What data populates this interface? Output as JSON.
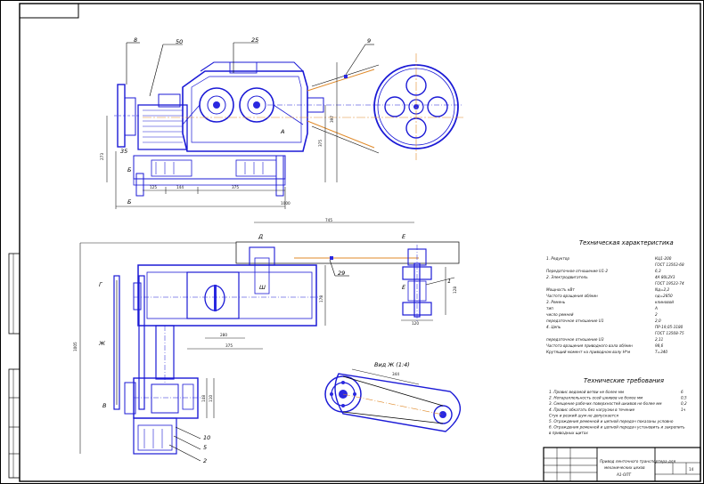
{
  "callouts": {
    "c8": "8",
    "c50": "50",
    "c25": "25",
    "c9": "9",
    "c29": "29",
    "c10": "10",
    "c5": "5",
    "c2": "2",
    "c1": "1",
    "cA": "А",
    "cB": "Б",
    "cB2": "Б",
    "cV": "В",
    "cG": "Г",
    "cZh": "Ж",
    "cD": "Д",
    "cE": "Е",
    "cE2": "Е",
    "cSh": "Ш",
    "c35": "35"
  },
  "dims": {
    "d125": "125",
    "d144": "144",
    "d375": "375",
    "d1000": "1000",
    "d273": "273",
    "d375v": "375",
    "d397": "397",
    "d745": "745",
    "d1005": "1005",
    "d280": "280",
    "d375b": "375",
    "d178": "178",
    "d148": "148",
    "d110": "110",
    "d128": "128",
    "d120": "120",
    "d344": "344"
  },
  "view_label": "Вид Ж (1:4)",
  "char_title": "Техническая характеристика",
  "char_rows": [
    {
      "label": "1. Редуктор",
      "value": "КЦ1-200"
    },
    {
      "label": "",
      "value": "ГОСТ 13563-68"
    },
    {
      "label": "Передаточное отношение U1-2",
      "value": "6,3"
    },
    {
      "label": "2. Электродвигатель",
      "value": "4А 80L2У3"
    },
    {
      "label": "",
      "value": "ГОСТ 19523-74"
    },
    {
      "label": "Мощность кВт",
      "value": "Nд=2,2"
    },
    {
      "label": "Частота вращения об/мин",
      "value": "nд=2850"
    },
    {
      "label": "3. Ремень",
      "value": "клиновой"
    },
    {
      "label": "тип",
      "value": "А"
    },
    {
      "label": "число ремней",
      "value": "2"
    },
    {
      "label": "передаточное отношение U1",
      "value": "2,0"
    },
    {
      "label": "4. Цепь",
      "value": "ПР-19,05-3180"
    },
    {
      "label": "",
      "value": "ГОСТ 13568-75"
    },
    {
      "label": "передаточное отношение U3",
      "value": "2,11"
    },
    {
      "label": "Частота вращения приводного вала об/мин",
      "value": "98,6"
    },
    {
      "label": "Крутящий момент на приводном валу Н*м",
      "value": "T=340"
    }
  ],
  "req_title": "Технические требования",
  "req_rows": [
    {
      "label": "1. Провис ведомой ветви не более мм",
      "value": "6"
    },
    {
      "label": "2. Непараллельность осей шкивов не более мм",
      "value": "0,5"
    },
    {
      "label": "3. Смещение рабочих поверхностей шкивов не более мм",
      "value": "0,2"
    },
    {
      "label": "4. Провис обкатать без нагрузки в течение",
      "value": "1ч"
    },
    {
      "label": "Стук и резкий шум не допускается",
      "value": ""
    },
    {
      "label": "5. Ограждения ременной и цепной передач показаны условно",
      "value": ""
    },
    {
      "label": "6. Ограждения ременной и цепной передач установить и закрепить",
      "value": ""
    },
    {
      "label": "в приводных щитах",
      "value": ""
    }
  ],
  "title_block": {
    "name_line1": "Привод ленточного транспортера для",
    "name_line2": "механических цехов",
    "code": "14",
    "ext": "А1-ОПТ"
  },
  "colors": {
    "lines": "#1b1ad6",
    "belt": "#e08a2a",
    "ink": "#000000"
  }
}
